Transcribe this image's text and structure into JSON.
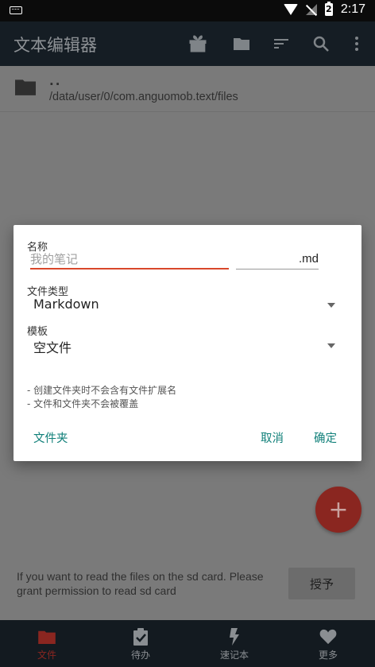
{
  "status_bar": {
    "time": "2:17",
    "battery_level": "2"
  },
  "app_bar": {
    "title": "文本编辑器",
    "icons": [
      "gift-icon",
      "folder-icon",
      "sort-icon",
      "search-icon",
      "more-vert-icon"
    ]
  },
  "file_list": {
    "parent_name": "..",
    "parent_path": "/data/user/0/com.anguomob.text/files"
  },
  "dialog": {
    "name_label": "名称",
    "name_placeholder": "我的笔记",
    "name_value": "",
    "extension": ".md",
    "type_label": "文件类型",
    "type_value": "Markdown",
    "template_label": "模板",
    "template_value": "空文件",
    "note_1": "- 创建文件夹时不会含有文件扩展名",
    "note_2": "- 文件和文件夹不会被覆盖",
    "folder_button": "文件夹",
    "cancel_button": "取消",
    "ok_button": "确定"
  },
  "fab": {
    "symbol": "+"
  },
  "permission": {
    "message": "If you want to read the files on the sd card. Please grant permission to read sd card",
    "grant_button": "授予"
  },
  "bottom_nav": {
    "tabs": [
      {
        "label": "文件",
        "icon": "folder-icon",
        "active": true
      },
      {
        "label": "待办",
        "icon": "clipboard-check-icon",
        "active": false
      },
      {
        "label": "速记本",
        "icon": "lightning-icon",
        "active": false
      },
      {
        "label": "更多",
        "icon": "heart-icon",
        "active": false
      }
    ]
  },
  "colors": {
    "accent": "#d9472b",
    "dialog_button": "#11807a",
    "scrim": "#7a7a7a"
  }
}
